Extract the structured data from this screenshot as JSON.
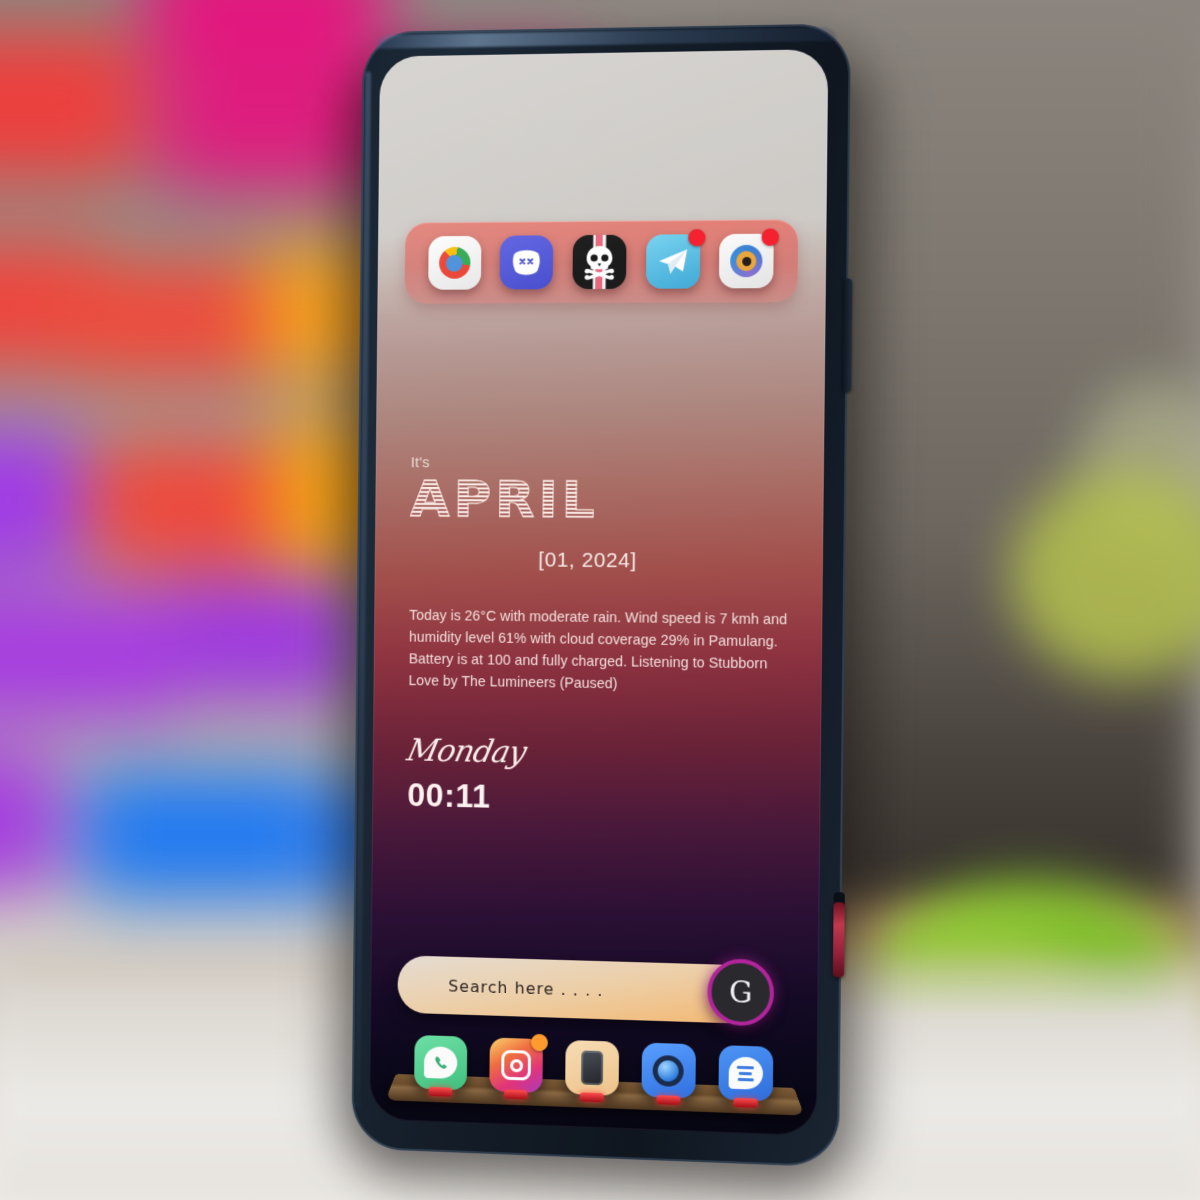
{
  "device": {
    "name": "smartphone",
    "frame_color": "#16202c",
    "accent_key_color": "#c0374c"
  },
  "wallpaper": {
    "gradient_top": "#cfccc8",
    "gradient_mid": "#a2504c",
    "gradient_bottom": "#060512"
  },
  "top_tray": {
    "background_color": "#e47a70",
    "apps": [
      {
        "name": "chrome",
        "label": "Chrome",
        "badge": ""
      },
      {
        "name": "discord",
        "label": "Discord",
        "badge": ""
      },
      {
        "name": "skull",
        "label": "Skull",
        "badge": ""
      },
      {
        "name": "telegram",
        "label": "Telegram",
        "badge": "notification"
      },
      {
        "name": "camera-eye",
        "label": "Camera",
        "badge": "notification"
      }
    ]
  },
  "widget": {
    "prefix": "It's",
    "month": "APRIL",
    "date": "[01, 2024]",
    "description": "Today is 26°C with moderate rain. Wind speed is 7 kmh and humidity level 61% with cloud coverage 29% in Pamulang. Battery is at 100 and fully charged. Listening to Stubborn Love by The Lumineers (Paused)",
    "weekday": "Monday",
    "time": "00:11"
  },
  "search": {
    "placeholder": "Search here . . . .",
    "value": "",
    "assistant_label": "G",
    "ring_color": "#b1259b"
  },
  "bottom_dock": {
    "apps": [
      {
        "name": "phone",
        "label": "Phone",
        "badge": ""
      },
      {
        "name": "instagram",
        "label": "Instagram",
        "badge": "notification"
      },
      {
        "name": "device",
        "label": "Device",
        "badge": ""
      },
      {
        "name": "assistant",
        "label": "Assistant",
        "badge": ""
      },
      {
        "name": "messages",
        "label": "Messages",
        "badge": ""
      }
    ]
  }
}
